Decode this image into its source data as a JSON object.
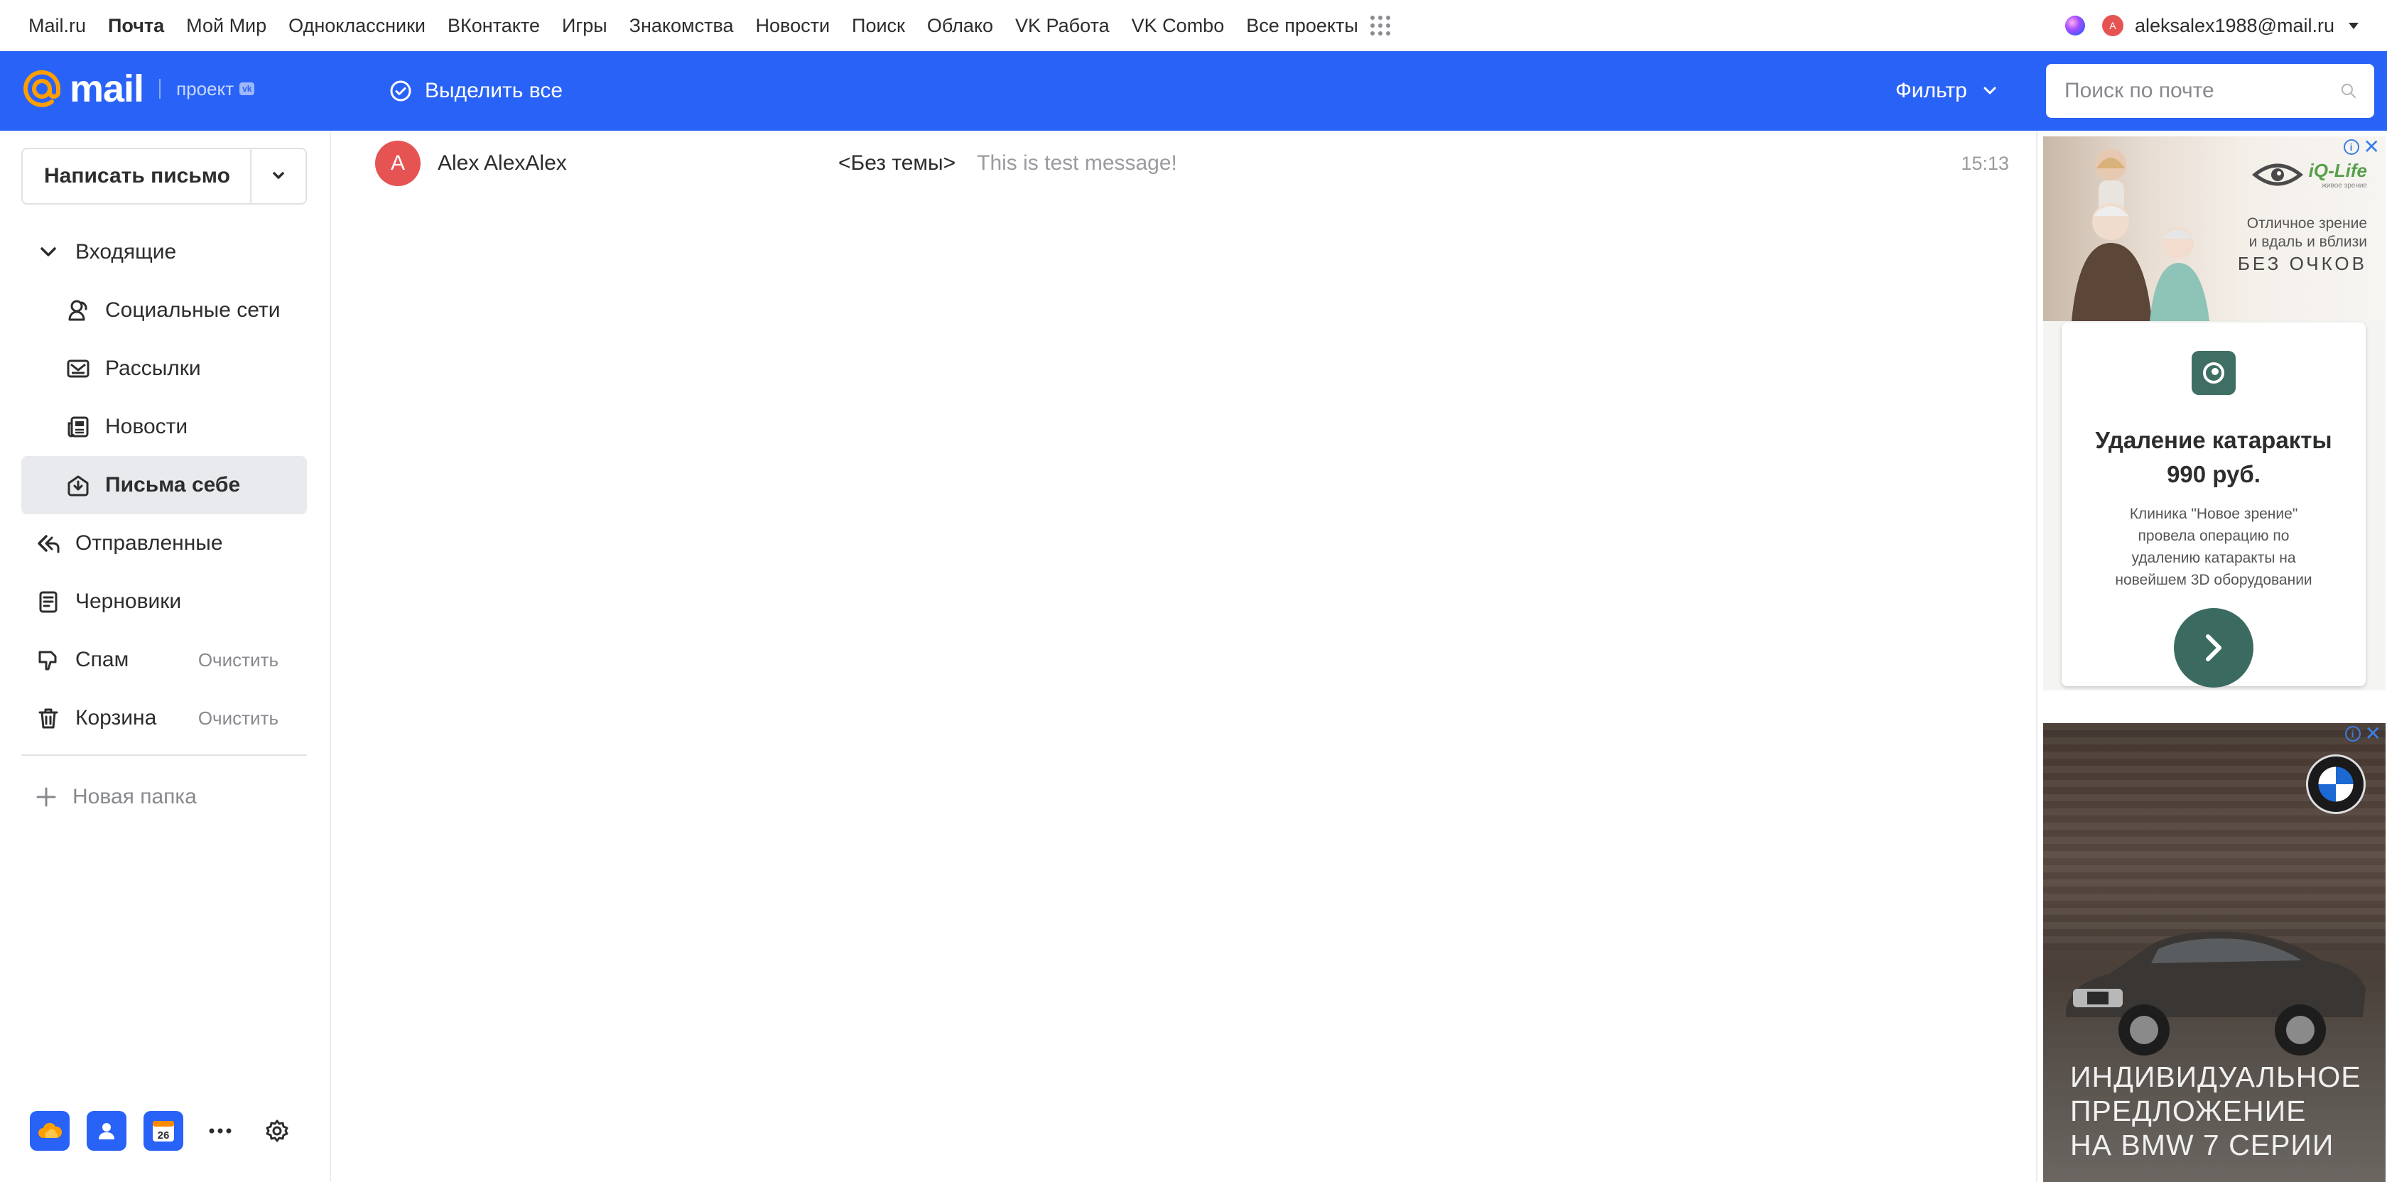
{
  "portal": {
    "nav": [
      "Mail.ru",
      "Почта",
      "Мой Мир",
      "Одноклассники",
      "ВКонтакте",
      "Игры",
      "Знакомства",
      "Новости",
      "Поиск",
      "Облако",
      "VK Работа",
      "VK Combo",
      "Все проекты"
    ],
    "active": "Почта",
    "account_email": "aleksalex1988@mail.ru",
    "account_initial": "A"
  },
  "header": {
    "logo_word": "mail",
    "logo_project": "проект",
    "logo_badge": "vk",
    "select_all": "Выделить все",
    "filter": "Фильтр",
    "search_placeholder": "Поиск по почте",
    "accent": "#2962f6"
  },
  "sidebar": {
    "compose": "Написать письмо",
    "folders": [
      {
        "label": "Входящие",
        "icon": "chevron-down-icon"
      },
      {
        "label": "Социальные сети",
        "icon": "social-icon"
      },
      {
        "label": "Рассылки",
        "icon": "newsletter-icon"
      },
      {
        "label": "Новости",
        "icon": "news-icon"
      },
      {
        "label": "Письма себе",
        "icon": "to-self-icon"
      },
      {
        "label": "Отправленные",
        "icon": "sent-icon"
      },
      {
        "label": "Черновики",
        "icon": "drafts-icon"
      },
      {
        "label": "Спам",
        "icon": "spam-icon",
        "action": "Очистить"
      },
      {
        "label": "Корзина",
        "icon": "trash-icon",
        "action": "Очистить"
      }
    ],
    "new_folder": "Новая папка",
    "calendar_day": "26"
  },
  "messages": [
    {
      "initial": "A",
      "from": "Alex AlexAlex",
      "subject": "<Без темы>",
      "snippet": "This is test message!",
      "time": "15:13"
    }
  ],
  "ads": {
    "ad1": {
      "brand": "iQ-Life",
      "brand_sub": "живое зрение",
      "tagline": "Отличное зрение\nи вдаль и вблизи",
      "tagline2": "БЕЗ ОЧКОВ",
      "headline": "Удаление катаракты 990 руб.",
      "body": "Клиника \"Новое зрение\" провела операцию по удалению катаракты на новейшем 3D оборудовании"
    },
    "ad2": {
      "logo": "BMW",
      "headline_l1": "ИНДИВИДУАЛЬНОЕ",
      "headline_l2": "ПРЕДЛОЖЕНИЕ",
      "headline_l3": "НА BMW 7 СЕРИИ"
    }
  }
}
